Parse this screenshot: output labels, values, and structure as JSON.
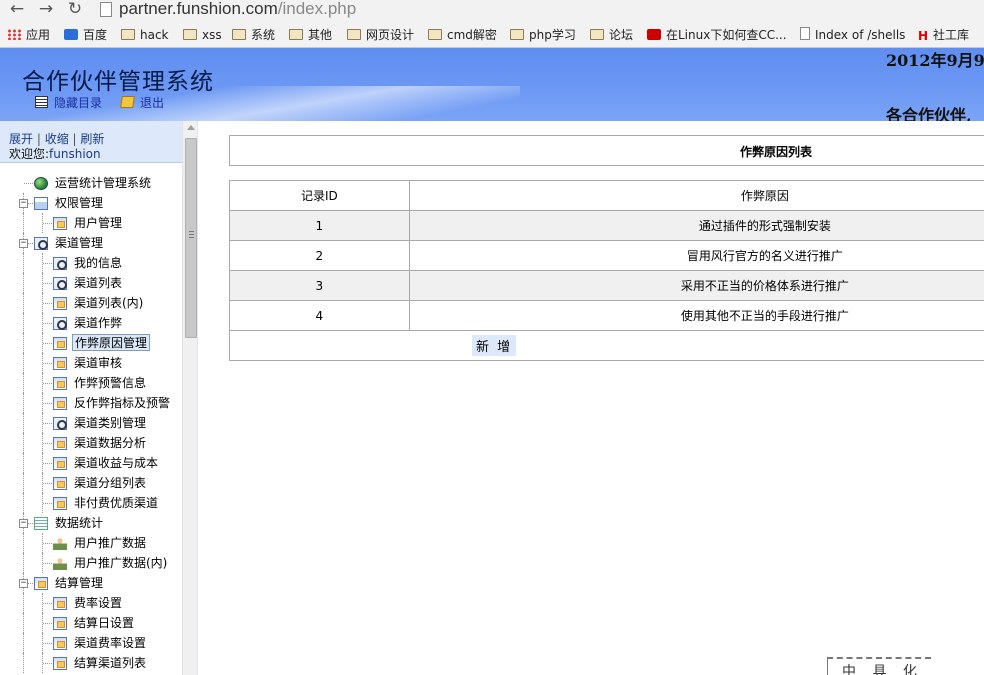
{
  "browser": {
    "url_host": "partner.funshion.com",
    "url_path": "/index.php",
    "bookmarks": [
      {
        "label": "应用",
        "icon": "apps-grid-icon"
      },
      {
        "label": "百度",
        "icon": "paw-icon"
      },
      {
        "label": "hack",
        "icon": "folder-icon"
      },
      {
        "label": "xss",
        "icon": "folder-icon"
      },
      {
        "label": "系统",
        "icon": "folder-icon"
      },
      {
        "label": "其他",
        "icon": "folder-icon"
      },
      {
        "label": "网页设计",
        "icon": "folder-icon"
      },
      {
        "label": "cmd解密",
        "icon": "folder-icon"
      },
      {
        "label": "php学习",
        "icon": "folder-icon"
      },
      {
        "label": "论坛",
        "icon": "folder-icon"
      },
      {
        "label": "在Linux下如何查CC...",
        "icon": "redhat-icon"
      },
      {
        "label": "Index of /shells",
        "icon": "page-icon"
      },
      {
        "label": "社工库",
        "icon": "h-logo-icon"
      }
    ]
  },
  "header": {
    "title": "合作伙伴管理系统",
    "hide_menu": "隐藏目录",
    "logout": "退出",
    "date": "2012年9月9",
    "greeting": "各合作伙伴,"
  },
  "sidebar": {
    "expand": "展开",
    "collapse": "收缩",
    "refresh": "刷新",
    "welcome_label": "欢迎您:",
    "username": "funshion",
    "tree": [
      {
        "label": "运营统计管理系统",
        "level": 0,
        "icon": "globe-icon"
      },
      {
        "label": "权限管理",
        "level": 1,
        "icon": "folder-icon",
        "toggle": "−"
      },
      {
        "label": "用户管理",
        "level": 2,
        "icon": "page-icon"
      },
      {
        "label": "渠道管理",
        "level": 1,
        "icon": "gear-icon",
        "toggle": "−"
      },
      {
        "label": "我的信息",
        "level": 2,
        "icon": "gear-icon"
      },
      {
        "label": "渠道列表",
        "level": 2,
        "icon": "gear-icon"
      },
      {
        "label": "渠道列表(内)",
        "level": 2,
        "icon": "page-icon"
      },
      {
        "label": "渠道作弊",
        "level": 2,
        "icon": "gear-icon"
      },
      {
        "label": "作弊原因管理",
        "level": 2,
        "icon": "page-icon",
        "selected": true
      },
      {
        "label": "渠道审核",
        "level": 2,
        "icon": "page-icon"
      },
      {
        "label": "作弊预警信息",
        "level": 2,
        "icon": "page-icon"
      },
      {
        "label": "反作弊指标及预警",
        "level": 2,
        "icon": "page-icon"
      },
      {
        "label": "渠道类别管理",
        "level": 2,
        "icon": "gear-icon"
      },
      {
        "label": "渠道数据分析",
        "level": 2,
        "icon": "page-icon"
      },
      {
        "label": "渠道收益与成本",
        "level": 2,
        "icon": "page-icon"
      },
      {
        "label": "渠道分组列表",
        "level": 2,
        "icon": "page-icon"
      },
      {
        "label": "非付费优质渠道",
        "level": 2,
        "icon": "page-icon"
      },
      {
        "label": "数据统计",
        "level": 1,
        "icon": "sheet-icon",
        "toggle": "−"
      },
      {
        "label": "用户推广数据",
        "level": 2,
        "icon": "person-icon"
      },
      {
        "label": "用户推广数据(内)",
        "level": 2,
        "icon": "person-icon"
      },
      {
        "label": "结算管理",
        "level": 1,
        "icon": "page-icon",
        "toggle": "−"
      },
      {
        "label": "费率设置",
        "level": 2,
        "icon": "page-icon"
      },
      {
        "label": "结算日设置",
        "level": 2,
        "icon": "page-icon"
      },
      {
        "label": "渠道费率设置",
        "level": 2,
        "icon": "page-icon"
      },
      {
        "label": "结算渠道列表",
        "level": 2,
        "icon": "page-icon"
      }
    ]
  },
  "main": {
    "table_title": "作弊原因列表",
    "columns": [
      "记录ID",
      "作弊原因"
    ],
    "rows": [
      {
        "id": "1",
        "reason": "通过插件的形式强制安装"
      },
      {
        "id": "2",
        "reason": "冒用风行官方的名义进行推广"
      },
      {
        "id": "3",
        "reason": "采用不正当的价格体系进行推广"
      },
      {
        "id": "4",
        "reason": "使用其他不正当的手段进行推广"
      }
    ],
    "add_label": "新 增",
    "stamp_text": "中 具 化"
  }
}
